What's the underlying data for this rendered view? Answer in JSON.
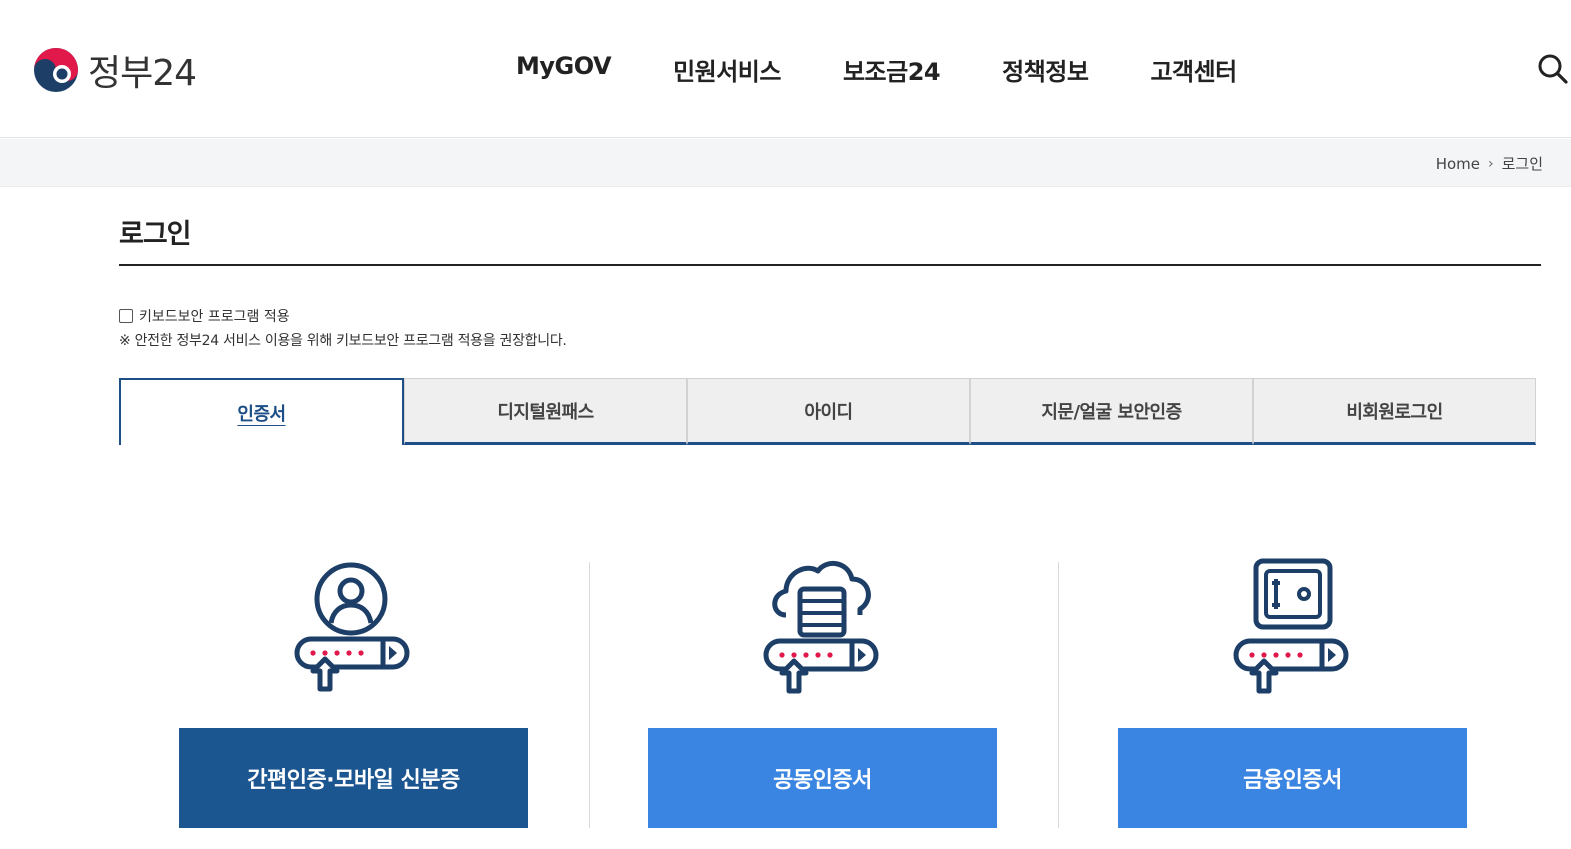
{
  "header": {
    "logo_text": "정부24",
    "nav": [
      "MyGOV",
      "민원서비스",
      "보조금24",
      "정책정보",
      "고객센터"
    ],
    "search_icon": "search-icon"
  },
  "breadcrumb": {
    "home": "Home",
    "current": "로그인"
  },
  "page": {
    "title": "로그인",
    "keyboard_security_label": "키보드보안 프로그램 적용",
    "keyboard_security_checked": false,
    "keyboard_note": "※ 안전한 정부24 서비스 이용을 위해 키보드보안 프로그램 적용을 권장합니다."
  },
  "tabs": [
    {
      "label": "인증서",
      "active": true
    },
    {
      "label": "디지털원패스",
      "active": false
    },
    {
      "label": "아이디",
      "active": false
    },
    {
      "label": "지문/얼굴 보안인증",
      "active": false
    },
    {
      "label": "비회원로그인",
      "active": false
    }
  ],
  "methods": [
    {
      "label": "간편인증·모바일 신분증",
      "icon": "user-login-icon",
      "style": "dark"
    },
    {
      "label": "공동인증서",
      "icon": "cloud-server-login-icon",
      "style": "light"
    },
    {
      "label": "금융인증서",
      "icon": "safe-login-icon",
      "style": "light"
    }
  ],
  "colors": {
    "primary_dark": "#1b5690",
    "primary_light": "#3a84e2",
    "tab_accent": "#1d4f86",
    "icon_navy": "#1d3e66",
    "icon_red": "#e0194a"
  }
}
